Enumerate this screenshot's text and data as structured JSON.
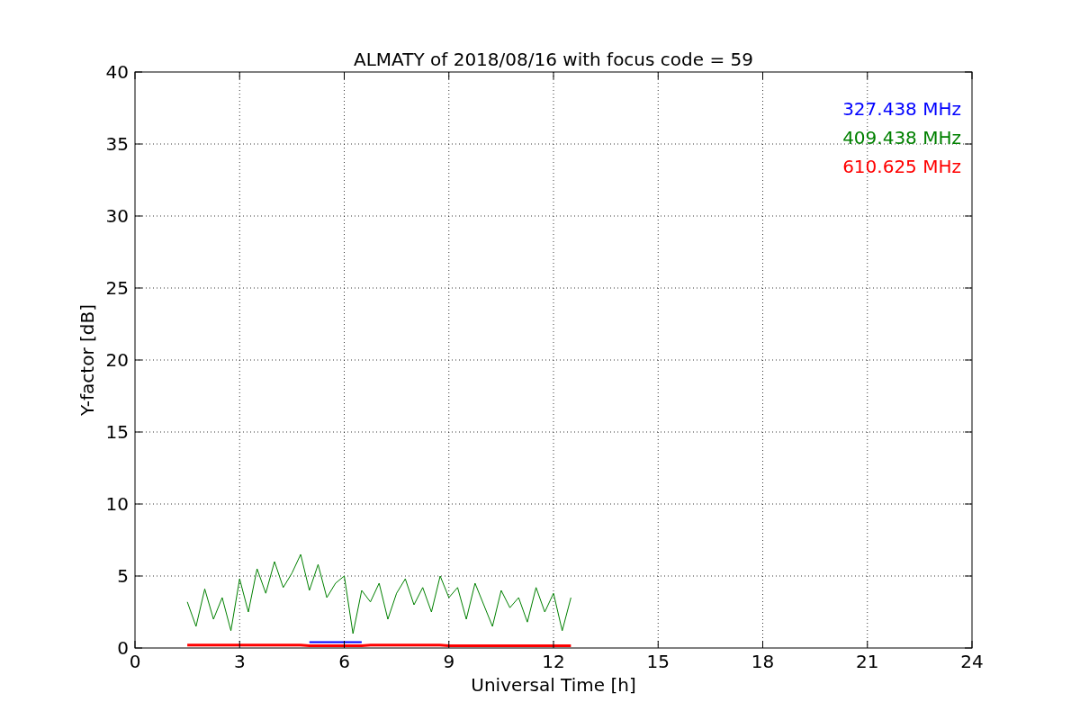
{
  "chart_data": {
    "type": "line",
    "title": "ALMATY of 2018/08/16 with focus code = 59",
    "xlabel": "Universal Time [h]",
    "ylabel": "Y-factor [dB]",
    "xlim": [
      0,
      24
    ],
    "ylim": [
      0,
      40
    ],
    "xticks": [
      0,
      3,
      6,
      9,
      12,
      15,
      18,
      21,
      24
    ],
    "yticks": [
      0,
      5,
      10,
      15,
      20,
      25,
      30,
      35,
      40
    ],
    "grid": true,
    "x": [
      1.5,
      1.75,
      2,
      2.25,
      2.5,
      2.75,
      3,
      3.25,
      3.5,
      3.75,
      4,
      4.25,
      4.5,
      4.75,
      5,
      5.25,
      5.5,
      5.75,
      6,
      6.25,
      6.5,
      6.75,
      7,
      7.25,
      7.5,
      7.75,
      8,
      8.25,
      8.5,
      8.75,
      9,
      9.25,
      9.5,
      9.75,
      10,
      10.25,
      10.5,
      10.75,
      11,
      11.25,
      11.5,
      11.75,
      12,
      12.25,
      12.5
    ],
    "series": [
      {
        "name": "327.438 MHz",
        "color": "#0000ff",
        "values": [
          null,
          null,
          null,
          null,
          null,
          null,
          null,
          null,
          null,
          null,
          null,
          null,
          null,
          null,
          0.4,
          0.4,
          0.4,
          0.4,
          0.4,
          0.4,
          0.4,
          null,
          null,
          null,
          null,
          null,
          null,
          null,
          null,
          null,
          null,
          null,
          null,
          null,
          null,
          null,
          null,
          null,
          null,
          null,
          null,
          null,
          null,
          null,
          null
        ]
      },
      {
        "name": "409.438 MHz",
        "color": "#008000",
        "values": [
          3.2,
          1.5,
          4.1,
          2.0,
          3.5,
          1.2,
          4.8,
          2.5,
          5.5,
          3.8,
          6.0,
          4.2,
          5.2,
          6.5,
          4.0,
          5.8,
          3.5,
          4.5,
          5.0,
          1.0,
          4.0,
          3.2,
          4.5,
          2.0,
          3.8,
          4.8,
          3.0,
          4.2,
          2.5,
          5.0,
          3.5,
          4.2,
          2.0,
          4.5,
          3.0,
          1.5,
          4.0,
          2.8,
          3.5,
          1.8,
          4.2,
          2.5,
          3.8,
          1.2,
          3.5
        ]
      },
      {
        "name": "610.625 MHz",
        "color": "#ff0000",
        "values": [
          0.2,
          0.2,
          0.2,
          0.2,
          0.2,
          0.2,
          0.2,
          0.2,
          0.2,
          0.2,
          0.2,
          0.2,
          0.2,
          0.2,
          0.15,
          0.15,
          0.15,
          0.15,
          0.15,
          0.15,
          0.15,
          0.2,
          0.2,
          0.2,
          0.2,
          0.2,
          0.2,
          0.2,
          0.2,
          0.2,
          0.15,
          0.15,
          0.15,
          0.15,
          0.15,
          0.15,
          0.15,
          0.15,
          0.15,
          0.15,
          0.15,
          0.15,
          0.15,
          0.15,
          0.15
        ]
      }
    ]
  }
}
